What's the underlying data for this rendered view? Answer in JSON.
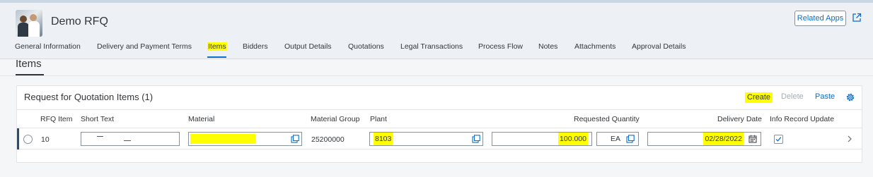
{
  "header": {
    "title": "Demo RFQ",
    "related_apps_label": "Related Apps"
  },
  "tabs": [
    {
      "label": "General Information"
    },
    {
      "label": "Delivery and Payment Terms"
    },
    {
      "label": "Items"
    },
    {
      "label": "Bidders"
    },
    {
      "label": "Output Details"
    },
    {
      "label": "Quotations"
    },
    {
      "label": "Legal Transactions"
    },
    {
      "label": "Process Flow"
    },
    {
      "label": "Notes"
    },
    {
      "label": "Attachments"
    },
    {
      "label": "Approval Details"
    }
  ],
  "active_tab": "Items",
  "section": {
    "title": "Items"
  },
  "panel": {
    "title": "Request for Quotation Items (1)",
    "toolbar": {
      "create": "Create",
      "delete": "Delete",
      "paste": "Paste"
    }
  },
  "table": {
    "columns": [
      "RFQ Item",
      "Short Text",
      "Material",
      "Material Group",
      "Plant",
      "Requested Quantity",
      "Delivery Date",
      "Info Record Update"
    ],
    "rows": [
      {
        "rfq_item": "10",
        "short_text": "",
        "material": "",
        "material_group": "25200000",
        "plant": "8103",
        "requested_quantity": "100.000",
        "unit": "EA",
        "delivery_date": "02/28/2022",
        "info_record_update": true
      }
    ]
  },
  "colors": {
    "accent": "#0a6ed1",
    "highlight": "#ffff00",
    "text": "#32363a",
    "row_indicator": "#354a5f"
  },
  "icons": [
    "avatar",
    "external-link-icon",
    "settings-gear-icon",
    "value-help-icon",
    "calendar-icon",
    "checkbox-checked-icon",
    "chevron-right-icon"
  ]
}
